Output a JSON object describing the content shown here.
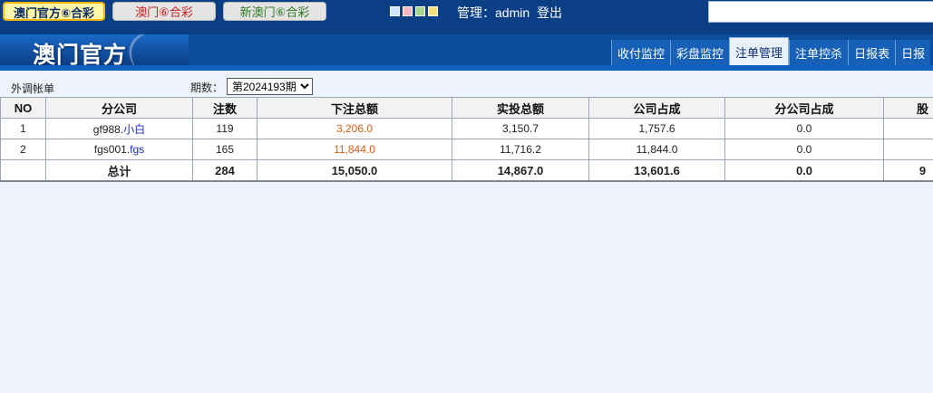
{
  "lottery_buttons": [
    {
      "label": "澳门官方⑥合彩"
    },
    {
      "label": "澳门⑥合彩"
    },
    {
      "label": "新澳门⑥合彩"
    }
  ],
  "theme_swatches": [
    "#cfe6ff",
    "#f7b6c8",
    "#a5d88f",
    "#f3e27a"
  ],
  "user": {
    "admin_label": "管理：admin",
    "logout_label": "登出"
  },
  "logo": {
    "text": "澳门官方"
  },
  "tabs": [
    {
      "label": "收付监控"
    },
    {
      "label": "彩盘监控"
    },
    {
      "label": "注单管理",
      "active": true
    },
    {
      "label": "注单控杀"
    },
    {
      "label": "日报表"
    },
    {
      "label": "日报"
    }
  ],
  "filter": {
    "title": "外调帐单",
    "period_label": "期数：",
    "period_value": "第2024193期"
  },
  "table": {
    "headers": [
      "NO",
      "分公司",
      "注数",
      "下注总额",
      "实投总额",
      "公司占成",
      "分公司占成",
      "股"
    ],
    "rows": [
      {
        "no": "1",
        "account": "gf988.",
        "nick": "小白",
        "count": "119",
        "bet_total": "3,206.0",
        "actual_total": "3,150.7",
        "company_share": "1,757.6",
        "branch_share": "0.0",
        "extra": ""
      },
      {
        "no": "2",
        "account": "fgs001.",
        "nick": "fgs",
        "count": "165",
        "bet_total": "11,844.0",
        "actual_total": "11,716.2",
        "company_share": "11,844.0",
        "branch_share": "0.0",
        "extra": ""
      }
    ],
    "total": {
      "label": "总计",
      "count": "284",
      "bet_total": "15,050.0",
      "actual_total": "14,867.0",
      "company_share": "13,601.6",
      "branch_share": "0.0",
      "extra": "9"
    }
  }
}
